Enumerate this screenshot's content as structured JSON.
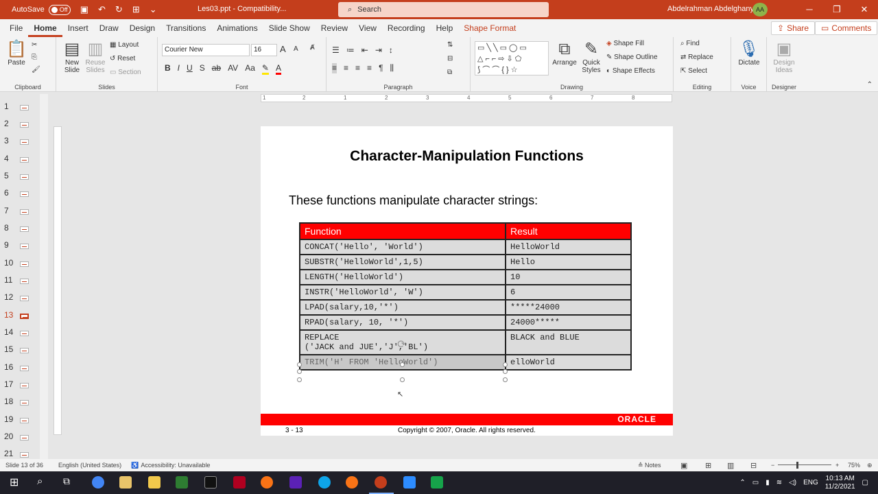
{
  "titlebar": {
    "autosave_label": "AutoSave",
    "autosave_state": "Off",
    "doc_title": "Les03.ppt  -  Compatibility...",
    "search_placeholder": "Search",
    "user_name": "Abdelrahman Abdelghany",
    "user_initials": "AA"
  },
  "tabs": [
    "File",
    "Home",
    "Insert",
    "Draw",
    "Design",
    "Transitions",
    "Animations",
    "Slide Show",
    "Review",
    "View",
    "Recording",
    "Help",
    "Shape Format"
  ],
  "active_tab": "Home",
  "share_label": "Share",
  "comments_label": "Comments",
  "ribbon": {
    "clipboard": {
      "paste": "Paste",
      "label": "Clipboard"
    },
    "slides": {
      "new_slide": "New Slide",
      "reuse_slides": "Reuse Slides",
      "layout": "Layout",
      "reset": "Reset",
      "section": "Section",
      "label": "Slides"
    },
    "font": {
      "font_name": "Courier New",
      "font_size": "16",
      "label": "Font"
    },
    "paragraph": {
      "label": "Paragraph"
    },
    "drawing": {
      "arrange": "Arrange",
      "quick_styles": "Quick Styles",
      "shape_fill": "Shape Fill",
      "shape_outline": "Shape Outline",
      "shape_effects": "Shape Effects",
      "label": "Drawing"
    },
    "editing": {
      "find": "Find",
      "replace": "Replace",
      "select": "Select",
      "label": "Editing"
    },
    "voice": {
      "dictate": "Dictate",
      "label": "Voice"
    },
    "designer": {
      "design_ideas": "Design Ideas",
      "label": "Designer"
    }
  },
  "thumbnails": [
    "1",
    "2",
    "3",
    "4",
    "5",
    "6",
    "7",
    "8",
    "9",
    "10",
    "11",
    "12",
    "13",
    "14",
    "15",
    "16",
    "17",
    "18",
    "19",
    "20",
    "21"
  ],
  "active_slide": "13",
  "ruler_marks": [
    "1",
    "2",
    "1",
    "1",
    "2",
    "3",
    "4",
    "5",
    "6",
    "7",
    "8"
  ],
  "slide": {
    "title": "Character-Manipulation Functions",
    "subtitle": "These functions manipulate character strings:",
    "table": {
      "headers": [
        "Function",
        "Result"
      ],
      "rows": [
        [
          "CONCAT('Hello', 'World')",
          "HelloWorld"
        ],
        [
          "SUBSTR('HelloWorld',1,5)",
          "Hello"
        ],
        [
          "LENGTH('HelloWorld')",
          "10"
        ],
        [
          "INSTR('HelloWorld', 'W')",
          "6"
        ],
        [
          "LPAD(salary,10,'*')",
          "*****24000"
        ],
        [
          "RPAD(salary, 10, '*')",
          "24000*****"
        ],
        [
          "REPLACE\n('JACK and JUE','J','BL')",
          "BLACK and BLUE"
        ],
        [
          "TRIM('H' FROM 'HelloWorld')",
          "elloWorld"
        ]
      ]
    },
    "footer_number": "3 - 13",
    "footer_copyright": "Copyright © 2007, Oracle. All rights reserved.",
    "oracle_logo": "ORACLE",
    "colors": {
      "accent_red": "#ff0000",
      "cell_gray": "#dcdcdc"
    }
  },
  "statusbar": {
    "slide_info": "Slide 13 of 36",
    "language": "English (United States)",
    "accessibility": "Accessibility: Unavailable",
    "notes": "Notes",
    "zoom": "75%"
  },
  "taskbar": {
    "lang": "ENG",
    "time": "10:13 AM",
    "date": "11/2/2021"
  }
}
